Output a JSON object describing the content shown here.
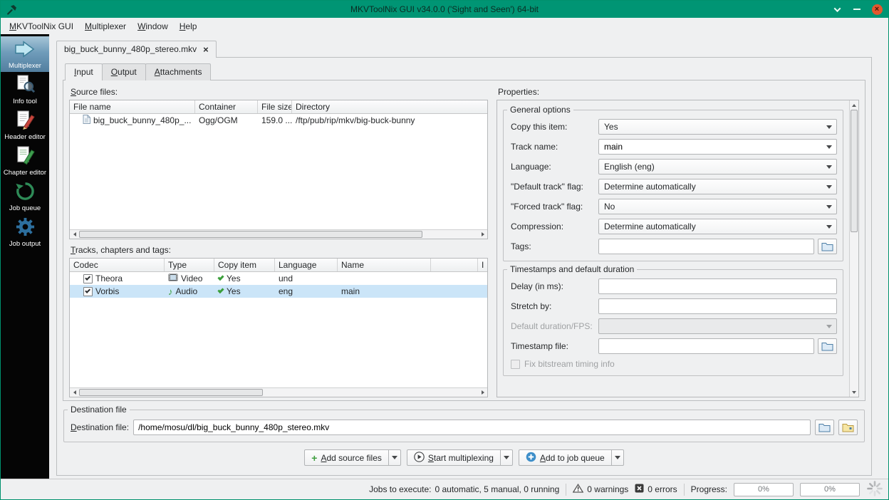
{
  "window": {
    "title": "MKVToolNix GUI v34.0.0 ('Sight and Seen') 64-bit"
  },
  "icons": {
    "close_tab": "×",
    "audio_note": "♪",
    "plus": "+"
  },
  "menubar": {
    "items": [
      "MKVToolNix GUI",
      "Multiplexer",
      "Window",
      "Help"
    ]
  },
  "sidebar": {
    "items": [
      {
        "label": "Multiplexer"
      },
      {
        "label": "Info tool"
      },
      {
        "label": "Header editor"
      },
      {
        "label": "Chapter editor"
      },
      {
        "label": "Job queue"
      },
      {
        "label": "Job output"
      }
    ]
  },
  "tabs": {
    "file_tab": "big_buck_bunny_480p_stereo.mkv",
    "sub_tabs": [
      "Input",
      "Output",
      "Attachments"
    ]
  },
  "source_files": {
    "label": "Source files:",
    "columns": [
      "File name",
      "Container",
      "File size",
      "Directory"
    ],
    "rows": [
      {
        "file_name": "big_buck_bunny_480p_...",
        "container": "Ogg/OGM",
        "file_size": "159.0 ...",
        "directory": "/ftp/pub/rip/mkv/big-buck-bunny"
      }
    ]
  },
  "tracks": {
    "label": "Tracks, chapters and tags:",
    "columns": [
      "Codec",
      "Type",
      "Copy item",
      "Language",
      "Name",
      "I"
    ],
    "rows": [
      {
        "codec": "Theora",
        "type": "Video",
        "copy_item": "Yes",
        "language": "und",
        "name": ""
      },
      {
        "codec": "Vorbis",
        "type": "Audio",
        "copy_item": "Yes",
        "language": "eng",
        "name": "main"
      }
    ]
  },
  "properties": {
    "label": "Properties:",
    "general": {
      "title": "General options",
      "fields": {
        "copy_this_item": {
          "label": "Copy this item:",
          "value": "Yes"
        },
        "track_name": {
          "label": "Track name:",
          "value": "main"
        },
        "language": {
          "label": "Language:",
          "value": "English (eng)"
        },
        "default_track_flag": {
          "label": "\"Default track\" flag:",
          "value": "Determine automatically"
        },
        "forced_track_flag": {
          "label": "\"Forced track\" flag:",
          "value": "No"
        },
        "compression": {
          "label": "Compression:",
          "value": "Determine automatically"
        },
        "tags": {
          "label": "Tags:",
          "value": ""
        }
      }
    },
    "timestamps": {
      "title": "Timestamps and default duration",
      "fields": {
        "delay": {
          "label": "Delay (in ms):",
          "value": ""
        },
        "stretch_by": {
          "label": "Stretch by:",
          "value": ""
        },
        "default_duration": {
          "label": "Default duration/FPS:",
          "value": ""
        },
        "timestamp_file": {
          "label": "Timestamp file:",
          "value": ""
        }
      },
      "fix_bitstream_label": "Fix bitstream timing info"
    }
  },
  "destination": {
    "group_title": "Destination file",
    "label": "Destination file:",
    "value": "/home/mosu/dl/big_buck_bunny_480p_stereo.mkv"
  },
  "actions": {
    "add_source_files": "Add source files",
    "start_multiplexing": "Start multiplexing",
    "add_to_job_queue": "Add to job queue"
  },
  "statusbar": {
    "jobs_label": "Jobs to execute:",
    "jobs_value": "0 automatic, 5 manual, 0 running",
    "warnings": "0 warnings",
    "errors": "0 errors",
    "progress_label": "Progress:",
    "progress_current": "0%",
    "progress_total": "0%"
  }
}
